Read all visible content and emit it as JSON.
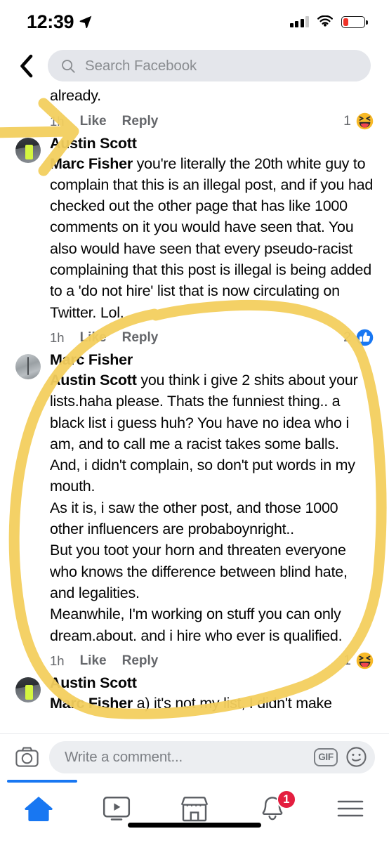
{
  "status_bar": {
    "time": "12:39",
    "location_icon": "location-arrow-icon",
    "signal_icon": "cellular-signal-icon",
    "wifi_icon": "wifi-icon",
    "battery_icon": "battery-low-icon",
    "battery_color": "#f03228"
  },
  "header": {
    "back_icon": "chevron-left-icon",
    "search_icon": "search-icon",
    "search_placeholder": "Search Facebook"
  },
  "comments": [
    {
      "author": "",
      "avatar": "",
      "text_truncated": "It really is surprising this wasn't taken down\nalready.",
      "time": "1h",
      "like_label": "Like",
      "reply_label": "Reply",
      "reaction_count": "1",
      "reaction_icon": "haha-emoji"
    },
    {
      "author": "Austin Scott",
      "avatar": "austin-scott-avatar",
      "mention": "Marc Fisher",
      "text": " you're literally the 20th white guy to complain that this is an illegal post, and if you had checked out the other page that has like 1000 comments on it you would have seen that. You also would have seen that every pseudo-racist complaining that this post is illegal is being added to a 'do not hire' list that is now circulating on Twitter. Lol.",
      "time": "1h",
      "like_label": "Like",
      "reply_label": "Reply",
      "reaction_count": "2",
      "reaction_icon": "like-thumbs-up-emoji"
    },
    {
      "author": "Marc Fisher",
      "avatar": "marc-fisher-avatar",
      "mention": "Austin Scott",
      "text": " you think i give 2 shits about your lists.haha please. Thats the funniest thing.. a black list i guess huh? You have no idea who i am, and to call me a racist takes some balls.\nAnd, i didn't complain, so don't put words in my mouth.\nAs it is, i saw the other post, and those 1000 other influencers are probaboynright..\nBut you toot your horn and threaten everyone who knows the difference between blind hate, and legalities.\nMeanwhile, I'm working on stuff you can only dream.about. and i hire who ever is qualified.",
      "time": "1h",
      "like_label": "Like",
      "reply_label": "Reply",
      "reaction_count": "1",
      "reaction_icon": "haha-emoji"
    },
    {
      "author": "Austin Scott",
      "avatar": "austin-scott-avatar",
      "mention": "Marc Fisher",
      "text": " a) it's not my list, I didn't make"
    }
  ],
  "annotations": {
    "highlight_color": "#f5d060",
    "arrow_name": "yellow-arrow-annotation",
    "circle_name": "yellow-circle-annotation"
  },
  "composer": {
    "camera_icon": "camera-icon",
    "placeholder": "Write a comment...",
    "gif_label": "GIF",
    "emoji_icon": "smiley-face-icon"
  },
  "tabbar": {
    "items": [
      {
        "name": "home",
        "icon": "home-icon",
        "active": true
      },
      {
        "name": "watch",
        "icon": "video-play-icon",
        "active": false
      },
      {
        "name": "marketplace",
        "icon": "storefront-icon",
        "active": false
      },
      {
        "name": "notifications",
        "icon": "bell-icon",
        "active": false,
        "badge": "1"
      },
      {
        "name": "menu",
        "icon": "hamburger-menu-icon",
        "active": false
      }
    ],
    "active_color": "#1877f2",
    "badge_color": "#e41e3f"
  }
}
